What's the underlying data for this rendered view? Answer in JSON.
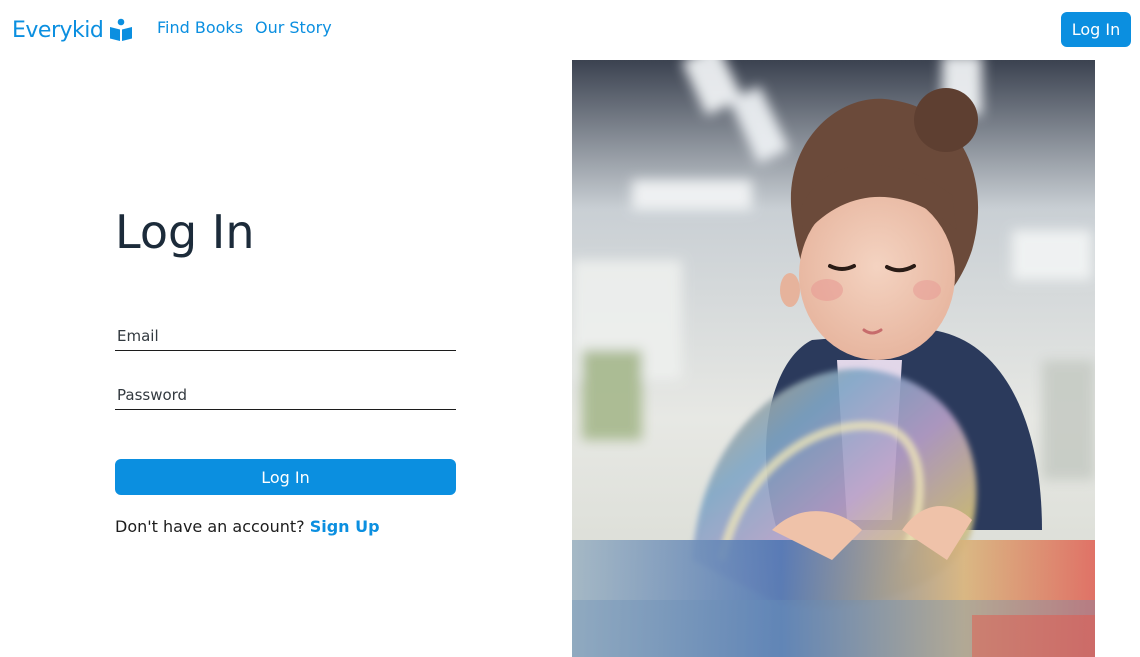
{
  "nav": {
    "brand": "Everykid",
    "links": [
      {
        "label": "Find Books"
      },
      {
        "label": "Our Story"
      }
    ],
    "login_label": "Log In"
  },
  "form": {
    "title": "Log In",
    "email_placeholder": "Email",
    "password_placeholder": "Password",
    "submit_label": "Log In",
    "signup_prompt": "Don't have an account?",
    "signup_link": "Sign Up"
  },
  "colors": {
    "brand": "#0b8fe0",
    "heading": "#1c2b3a"
  },
  "icons": {
    "brand_logo": "open-book-reader-icon"
  }
}
